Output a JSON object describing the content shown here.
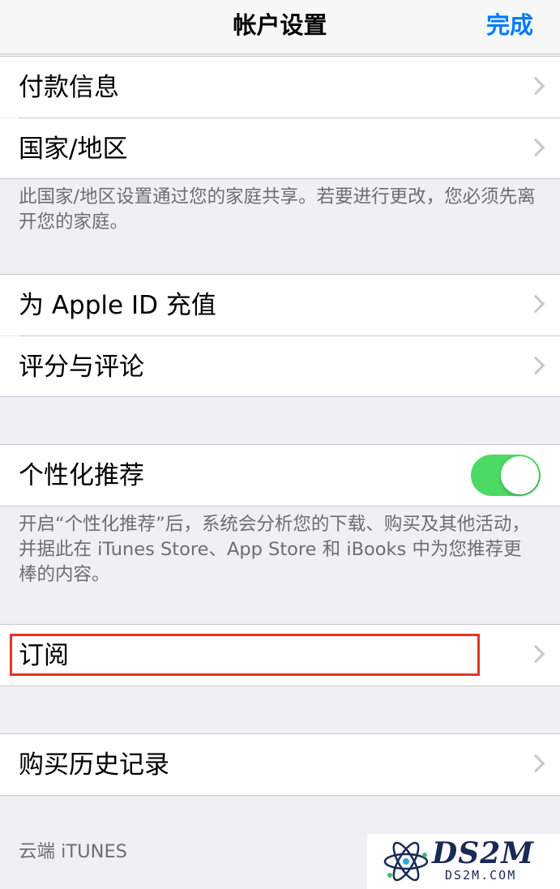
{
  "navbar": {
    "title": "帐户设置",
    "done_label": "完成"
  },
  "group1": {
    "items": [
      {
        "label": "付款信息"
      },
      {
        "label": "国家/地区"
      }
    ],
    "footer": "此国家/地区设置通过您的家庭共享。若要进行更改，您必须先离开您的家庭。"
  },
  "group2": {
    "items": [
      {
        "label": "为 Apple ID 充值"
      },
      {
        "label": "评分与评论"
      }
    ]
  },
  "group3": {
    "item_label": "个性化推荐",
    "toggle_on": true,
    "footer": "开启“个性化推荐”后，系统会分析您的下载、购买及其他活动，并据此在 iTunes Store、App Store 和 iBooks 中为您推荐更棒的内容。"
  },
  "group4": {
    "item_label": "订阅"
  },
  "group5": {
    "item_label": "购买历史记录"
  },
  "section_header": "云端 iTUNES",
  "watermark": {
    "brand": "DS2M",
    "domain": "DS2M.COM"
  },
  "colors": {
    "accent": "#007aff",
    "toggle_on": "#4cd964",
    "highlight": "#e8332a"
  }
}
